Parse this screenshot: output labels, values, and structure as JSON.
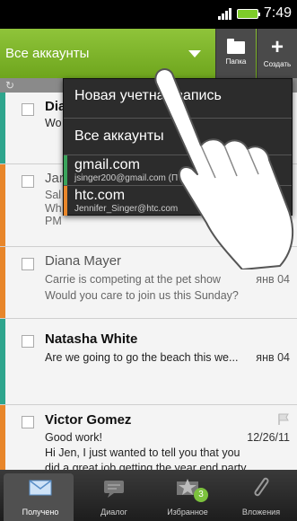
{
  "status_bar": {
    "time": "7:49"
  },
  "action_bar": {
    "account_label": "Все аккаунты",
    "folder_label": "Папка",
    "create_label": "Создать"
  },
  "account_menu": {
    "new_account": "Новая учетная запись",
    "all_accounts": "Все аккаунты",
    "accounts": [
      {
        "name": "gmail.com",
        "email": "jsinger200@gmail.com (П",
        "color": "#3aa35b"
      },
      {
        "name": "htc.com",
        "email": "Jennifer_Singer@htc.com",
        "color": "#e8862a"
      }
    ]
  },
  "messages": [
    {
      "sender": "Dia",
      "line1": "Wo",
      "line2": "",
      "line3": "",
      "date": "",
      "unread": true,
      "stripe": "#2ea58d"
    },
    {
      "sender": "Jar",
      "line1": "Sal",
      "line2": "Wh",
      "line3": "PM",
      "date": "",
      "unread": false,
      "stripe": "#e8862a"
    },
    {
      "sender": "Diana Mayer",
      "line1": "Carrie is competing at the pet show",
      "line2": "Would you care to join us this Sunday?",
      "line3": "",
      "date": "янв 04",
      "unread": false,
      "stripe": "#e8862a"
    },
    {
      "sender": "Natasha White",
      "line1": "Are we going to go the beach this we...",
      "line2": "",
      "line3": "",
      "date": "янв 04",
      "unread": true,
      "stripe": "#2ea58d"
    },
    {
      "sender": "Victor Gomez",
      "line1": "Good work!",
      "line2": "Hi Jen, I just wanted to tell you that you",
      "line3": "did a great job getting the year end party",
      "date": "12/26/11",
      "unread": true,
      "stripe": "#e8862a"
    }
  ],
  "tabs": [
    {
      "label": "Получено",
      "icon": "inbox-envelope-icon"
    },
    {
      "label": "Диалог",
      "icon": "conversation-icon"
    },
    {
      "label": "Избранное",
      "icon": "favorites-star-icon",
      "badge": "3"
    },
    {
      "label": "Вложения",
      "icon": "paperclip-icon"
    }
  ],
  "colors": {
    "accent_green": "#7cb32c",
    "teal_stripe": "#2ea58d",
    "orange_stripe": "#e8862a"
  }
}
